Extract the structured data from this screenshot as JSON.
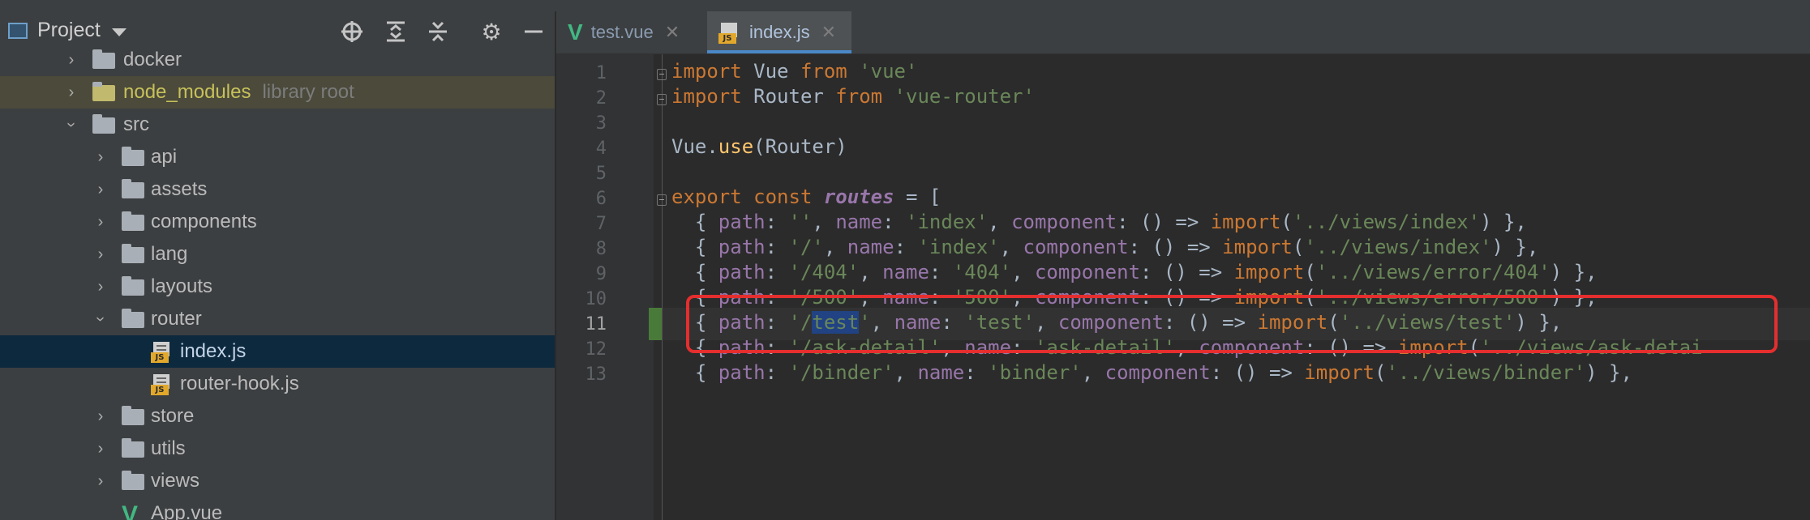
{
  "project_panel": {
    "title": "Project",
    "tools": [
      "locate-icon",
      "expand-all-icon",
      "collapse-all-icon",
      "gear-icon",
      "minimize-icon"
    ],
    "tree": [
      {
        "label": "docker",
        "kind": "folder",
        "state": "collapsed",
        "depth": 2
      },
      {
        "label": "node_modules",
        "hint": "library root",
        "kind": "folder",
        "state": "collapsed",
        "depth": 2
      },
      {
        "label": "src",
        "kind": "folder",
        "state": "expanded",
        "depth": 2
      },
      {
        "label": "api",
        "kind": "folder",
        "state": "collapsed",
        "depth": 3
      },
      {
        "label": "assets",
        "kind": "folder",
        "state": "collapsed",
        "depth": 3
      },
      {
        "label": "components",
        "kind": "folder",
        "state": "collapsed",
        "depth": 3
      },
      {
        "label": "lang",
        "kind": "folder",
        "state": "collapsed",
        "depth": 3
      },
      {
        "label": "layouts",
        "kind": "folder",
        "state": "collapsed",
        "depth": 3
      },
      {
        "label": "router",
        "kind": "folder",
        "state": "expanded",
        "depth": 3
      },
      {
        "label": "index.js",
        "kind": "js",
        "selected": true,
        "depth": 4
      },
      {
        "label": "router-hook.js",
        "kind": "js",
        "depth": 4
      },
      {
        "label": "store",
        "kind": "folder",
        "state": "collapsed",
        "depth": 3
      },
      {
        "label": "utils",
        "kind": "folder",
        "state": "collapsed",
        "depth": 3
      },
      {
        "label": "views",
        "kind": "folder",
        "state": "collapsed",
        "depth": 3
      },
      {
        "label": "App.vue",
        "kind": "vue",
        "depth": 3
      }
    ]
  },
  "editor": {
    "tabs": [
      {
        "label": "test.vue",
        "kind": "vue",
        "active": false
      },
      {
        "label": "index.js",
        "kind": "js",
        "active": true
      }
    ],
    "current_line": 11,
    "line_numbers": [
      "1",
      "2",
      "3",
      "4",
      "5",
      "6",
      "7",
      "8",
      "9",
      "10",
      "11",
      "12",
      "13"
    ],
    "code_lines": [
      "import Vue from 'vue'",
      "import Router from 'vue-router'",
      "",
      "Vue.use(Router)",
      "",
      "export const routes = [",
      "  { path: '', name: 'index', component: () => import('../views/index') },",
      "  { path: '/', name: 'index', component: () => import('../views/index') },",
      "  { path: '/404', name: '404', component: () => import('../views/error/404') },",
      "  { path: '/500', name: '500', component: () => import('../views/error/500') },",
      "  { path: '/test', name: 'test', component: () => import('../views/test') },",
      "  { path: '/ask-detail', name: 'ask-detail', component: () => import('../views/ask-detai",
      "  { path: '/binder', name: 'binder', component: () => import('../views/binder') },"
    ]
  },
  "colors": {
    "keyword": "#cc7832",
    "string": "#6a8759",
    "property": "#9876aa",
    "function": "#ffc66d",
    "text": "#a9b7c6",
    "selection": "#214283",
    "annotation": "#e52e2e",
    "tree_selected": "#0d293e",
    "library_root_row": "#4b4a3b"
  }
}
